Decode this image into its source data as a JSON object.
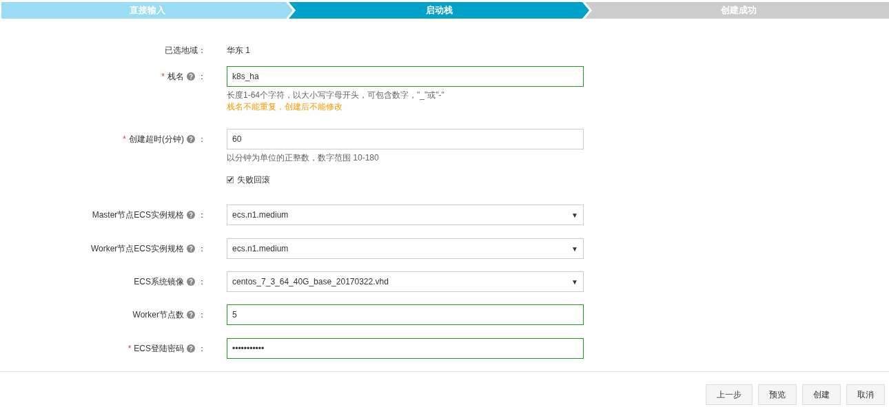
{
  "steps": [
    {
      "label": "直接输入",
      "done": true,
      "selected": false
    },
    {
      "label": "启动栈",
      "done": false,
      "selected": true
    },
    {
      "label": "创建成功",
      "done": false,
      "selected": false
    }
  ],
  "form": [
    {
      "kind": "static",
      "label": "已选地域：",
      "value": "华东 1"
    },
    {
      "kind": "input",
      "required_mark": "*",
      "label": "栈名",
      "help": true,
      "colon": "：",
      "value": "k8s_ha",
      "valid": true,
      "hints": [
        {
          "text": "长度1-64个字符，以大小写字母开头，可包含数字，\"_\"或\"-\"",
          "kind": "info"
        },
        {
          "text": "栈名不能重复，创建后不能修改",
          "kind": "warning"
        }
      ]
    },
    {
      "kind": "input",
      "required_mark": "*",
      "label": "创建超时(分钟)",
      "help": true,
      "colon": "：",
      "value": "60",
      "valid": false,
      "hints": [
        {
          "text": "以分钟为单位的正整数，数字范围 10-180",
          "kind": "info"
        }
      ]
    },
    {
      "kind": "checkbox",
      "label": "失败回滚",
      "checked": true
    },
    {
      "kind": "select",
      "label": "Master节点ECS实例规格",
      "help": true,
      "colon": "：",
      "value": "ecs.n1.medium",
      "arrow": "▼"
    },
    {
      "kind": "select",
      "label": "Worker节点ECS实例规格",
      "help": true,
      "colon": "：",
      "value": "ecs.n1.medium",
      "arrow": "▼"
    },
    {
      "kind": "select",
      "label": "ECS系统镜像",
      "help": true,
      "colon": "：",
      "value": "centos_7_3_64_40G_base_20170322.vhd",
      "arrow": "▼"
    },
    {
      "kind": "input",
      "label": "Worker节点数",
      "help": true,
      "colon": "：",
      "value": "5",
      "valid": true
    },
    {
      "kind": "password",
      "required_mark": "*",
      "label": "ECS登陆密码",
      "help": true,
      "colon": "：",
      "value": "•••••••••••",
      "valid": true
    }
  ],
  "buttons": [
    "上一步",
    "预览",
    "创建",
    "取消"
  ]
}
